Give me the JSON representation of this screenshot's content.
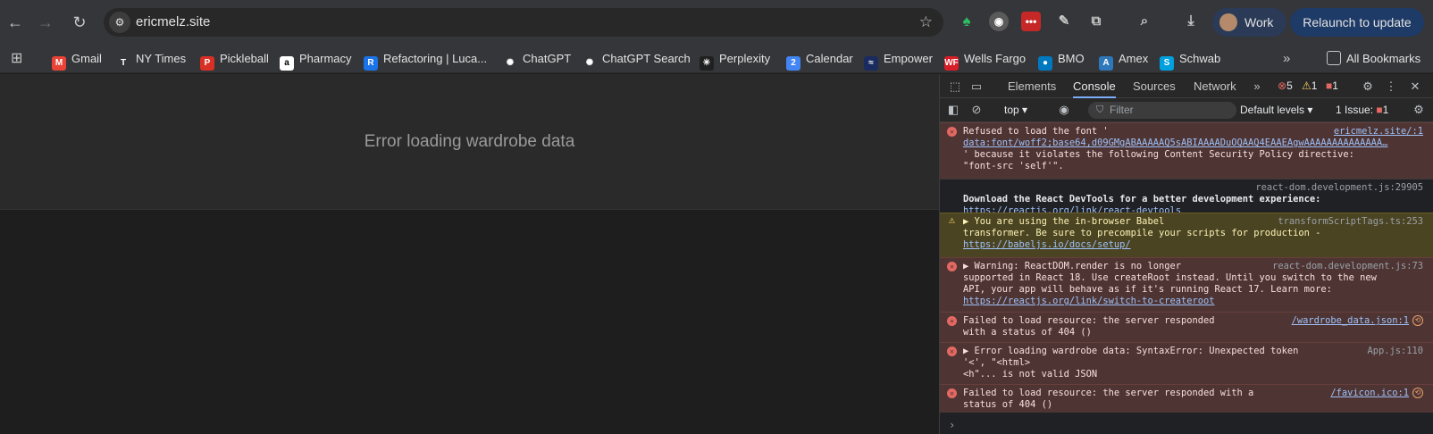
{
  "browser": {
    "url": "ericmelz.site",
    "profile_label": "Work",
    "relaunch_label": "Relaunch to update"
  },
  "bookmarks": {
    "items": [
      {
        "label": "Gmail",
        "color": "#ea4335",
        "glyph": "M"
      },
      {
        "label": "NY Times",
        "color": "#35363a",
        "glyph": "T"
      },
      {
        "label": "Pickleball",
        "color": "#d93025",
        "glyph": "P"
      },
      {
        "label": "Pharmacy",
        "color": "#ffffff",
        "glyph": "a"
      },
      {
        "label": "Refactoring | Luca...",
        "color": "#1a73e8",
        "glyph": "R"
      },
      {
        "label": "ChatGPT",
        "color": "#35363a",
        "glyph": "✺"
      },
      {
        "label": "ChatGPT Search",
        "color": "#35363a",
        "glyph": "✺"
      },
      {
        "label": "Perplexity",
        "color": "#202020",
        "glyph": "✳"
      },
      {
        "label": "Calendar",
        "color": "#4285f4",
        "glyph": "2"
      },
      {
        "label": "Empower",
        "color": "#1a2b5f",
        "glyph": "≈"
      },
      {
        "label": "Wells Fargo",
        "color": "#d71e28",
        "glyph": "WF"
      },
      {
        "label": "BMO",
        "color": "#0079c1",
        "glyph": "●"
      },
      {
        "label": "Amex",
        "color": "#2e77bb",
        "glyph": "A"
      },
      {
        "label": "Schwab",
        "color": "#00a0df",
        "glyph": "S"
      }
    ],
    "all_bookmarks_label": "All Bookmarks"
  },
  "page": {
    "message": "Error loading wardrobe data"
  },
  "devtools": {
    "tabs": [
      "Elements",
      "Console",
      "Sources",
      "Network"
    ],
    "active_tab": "Console",
    "error_count": "5",
    "warning_count": "1",
    "issue_count": "1",
    "context": "top",
    "filter_placeholder": "Filter",
    "levels_label": "Default levels",
    "issues_label": "1 Issue:",
    "issues_count": "1"
  },
  "console": {
    "messages": [
      {
        "level": "error",
        "lines": [
          "Refused to load the font '",
          "data:font/woff2;base64,d09GMgABAAAAAQ5sABIAAAADuOQAAQ4EAAEAgwAAAAAAAAAAAAAA…",
          "' because it violates the following Content Security Policy directive:",
          "\"font-src 'self'\"."
        ],
        "source": "ericmelz.site/:1"
      },
      {
        "level": "info",
        "lines": [
          "Download the React DevTools for a better development experience:",
          "https://reactjs.org/link/react-devtools"
        ],
        "source": "react-dom.development.js:29905"
      },
      {
        "level": "warning",
        "lines": [
          "▶ You are using the in-browser Babel",
          "transformer. Be sure to precompile your scripts for production -",
          "https://babeljs.io/docs/setup/"
        ],
        "source": "transformScriptTags.ts:253"
      },
      {
        "level": "error",
        "lines": [
          "▶ Warning: ReactDOM.render is no longer",
          "supported in React 18. Use createRoot instead. Until you switch to the new",
          "API, your app will behave as if it's running React 17. Learn more:",
          "https://reactjs.org/link/switch-to-createroot"
        ],
        "source": "react-dom.development.js:73"
      },
      {
        "level": "error",
        "lines": [
          "Failed to load resource: the server responded",
          "with a status of 404 ()"
        ],
        "source": "/wardrobe_data.json:1"
      },
      {
        "level": "error",
        "lines": [
          "▶ Error loading wardrobe data: SyntaxError: Unexpected token",
          "'<', \"<html>",
          "<h\"... is not valid JSON"
        ],
        "source": "App.js:110"
      },
      {
        "level": "error",
        "lines": [
          "Failed to load resource: the server responded with a",
          "status of 404 ()"
        ],
        "source": "/favicon.ico:1"
      }
    ],
    "prompt": "›"
  }
}
